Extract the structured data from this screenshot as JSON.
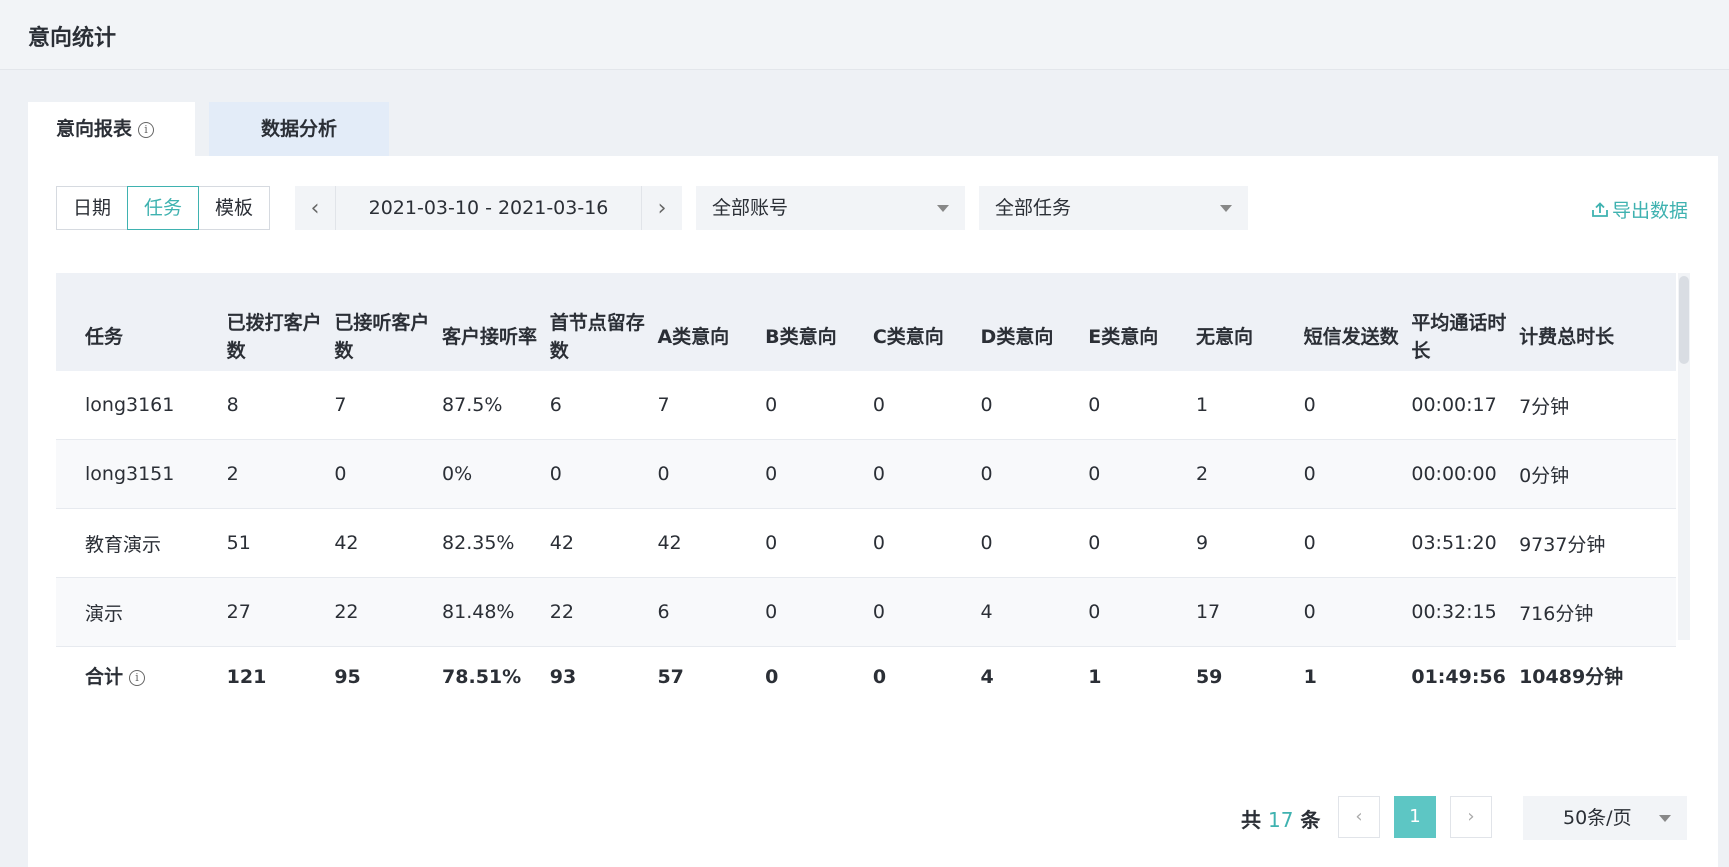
{
  "header": {
    "title": "意向统计"
  },
  "tabs": [
    {
      "label": "意向报表"
    },
    {
      "label": "数据分析"
    }
  ],
  "filters": {
    "segments": [
      "日期",
      "任务",
      "模板"
    ],
    "active_segment": "任务",
    "date_range": "2021-03-10 - 2021-03-16",
    "account_select": "全部账号",
    "task_select": "全部任务",
    "export_label": "导出数据"
  },
  "table": {
    "columns": [
      "任务",
      "已拨打客户数",
      "已接听客户数",
      "客户接听率",
      "首节点留存数",
      "A类意向",
      "B类意向",
      "C类意向",
      "D类意向",
      "E类意向",
      "无意向",
      "短信发送数",
      "平均通话时长",
      "计费总时长"
    ],
    "rows": [
      [
        "long3161",
        "8",
        "7",
        "87.5%",
        "6",
        "7",
        "0",
        "0",
        "0",
        "0",
        "1",
        "0",
        "00:00:17",
        "7分钟"
      ],
      [
        "long3151",
        "2",
        "0",
        "0%",
        "0",
        "0",
        "0",
        "0",
        "0",
        "0",
        "2",
        "0",
        "00:00:00",
        "0分钟"
      ],
      [
        "教育演示",
        "51",
        "42",
        "82.35%",
        "42",
        "42",
        "0",
        "0",
        "0",
        "0",
        "9",
        "0",
        "03:51:20",
        "9737分钟"
      ],
      [
        "演示",
        "27",
        "22",
        "81.48%",
        "22",
        "6",
        "0",
        "0",
        "4",
        "0",
        "17",
        "0",
        "00:32:15",
        "716分钟"
      ]
    ],
    "totals": [
      "合计",
      "121",
      "95",
      "78.51%",
      "93",
      "57",
      "0",
      "0",
      "4",
      "1",
      "59",
      "1",
      "01:49:56",
      "10489分钟"
    ]
  },
  "pagination": {
    "total_prefix": "共",
    "total_count": "17",
    "total_suffix": "条",
    "current_page": "1",
    "page_size": "50条/页"
  }
}
